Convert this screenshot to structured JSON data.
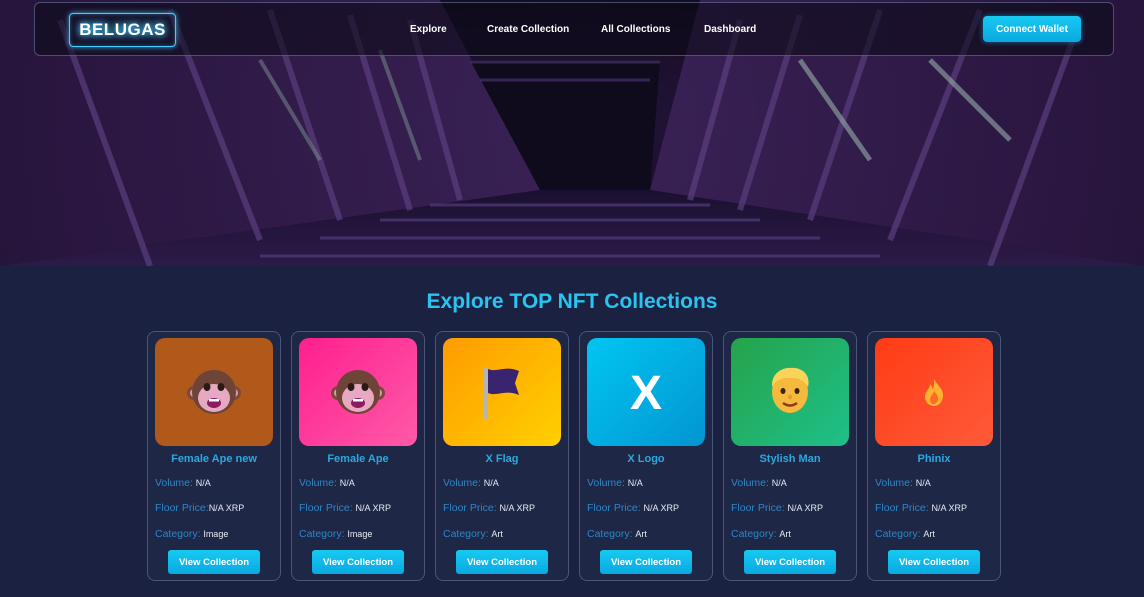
{
  "navbar": {
    "logo": "BELUGAS",
    "links": [
      "Explore",
      "Create Collection",
      "All Collections",
      "Dashboard"
    ],
    "connect_label": "Connect Wallet"
  },
  "section": {
    "title": "Explore TOP NFT Collections"
  },
  "labels": {
    "volume": "Volume:",
    "floor": "Floor Price:",
    "category": "Category:",
    "button": "View Collection"
  },
  "collections": [
    {
      "name": "Female Ape new",
      "volume": "N/A",
      "floor": "N/A XRP",
      "category": "Image",
      "icon": "monkey-face-icon",
      "bg": "#b0591a"
    },
    {
      "name": "Female Ape",
      "volume": "N/A",
      "floor": "N/A XRP",
      "category": "Image",
      "icon": "monkey-face-icon",
      "bg": "#ff2f93"
    },
    {
      "name": "X Flag",
      "volume": "N/A",
      "floor": "N/A XRP",
      "category": "Art",
      "icon": "flag-icon",
      "bg": "#ffb100"
    },
    {
      "name": "X Logo",
      "volume": "N/A",
      "floor": "N/A XRP",
      "category": "Art",
      "icon": "x-logo-icon",
      "bg": "#08b6e8"
    },
    {
      "name": "Stylish Man",
      "volume": "N/A",
      "floor": "N/A XRP",
      "category": "Art",
      "icon": "man-face-icon",
      "bg": "#1ea85a"
    },
    {
      "name": "Phinix",
      "volume": "N/A",
      "floor": "N/A XRP",
      "category": "Art",
      "icon": "flame-icon",
      "bg": "#ff4a1f"
    }
  ],
  "colors": {
    "accent": "#29c4f2",
    "page_bg": "#1b2140",
    "card_bg": "#1f2746"
  }
}
